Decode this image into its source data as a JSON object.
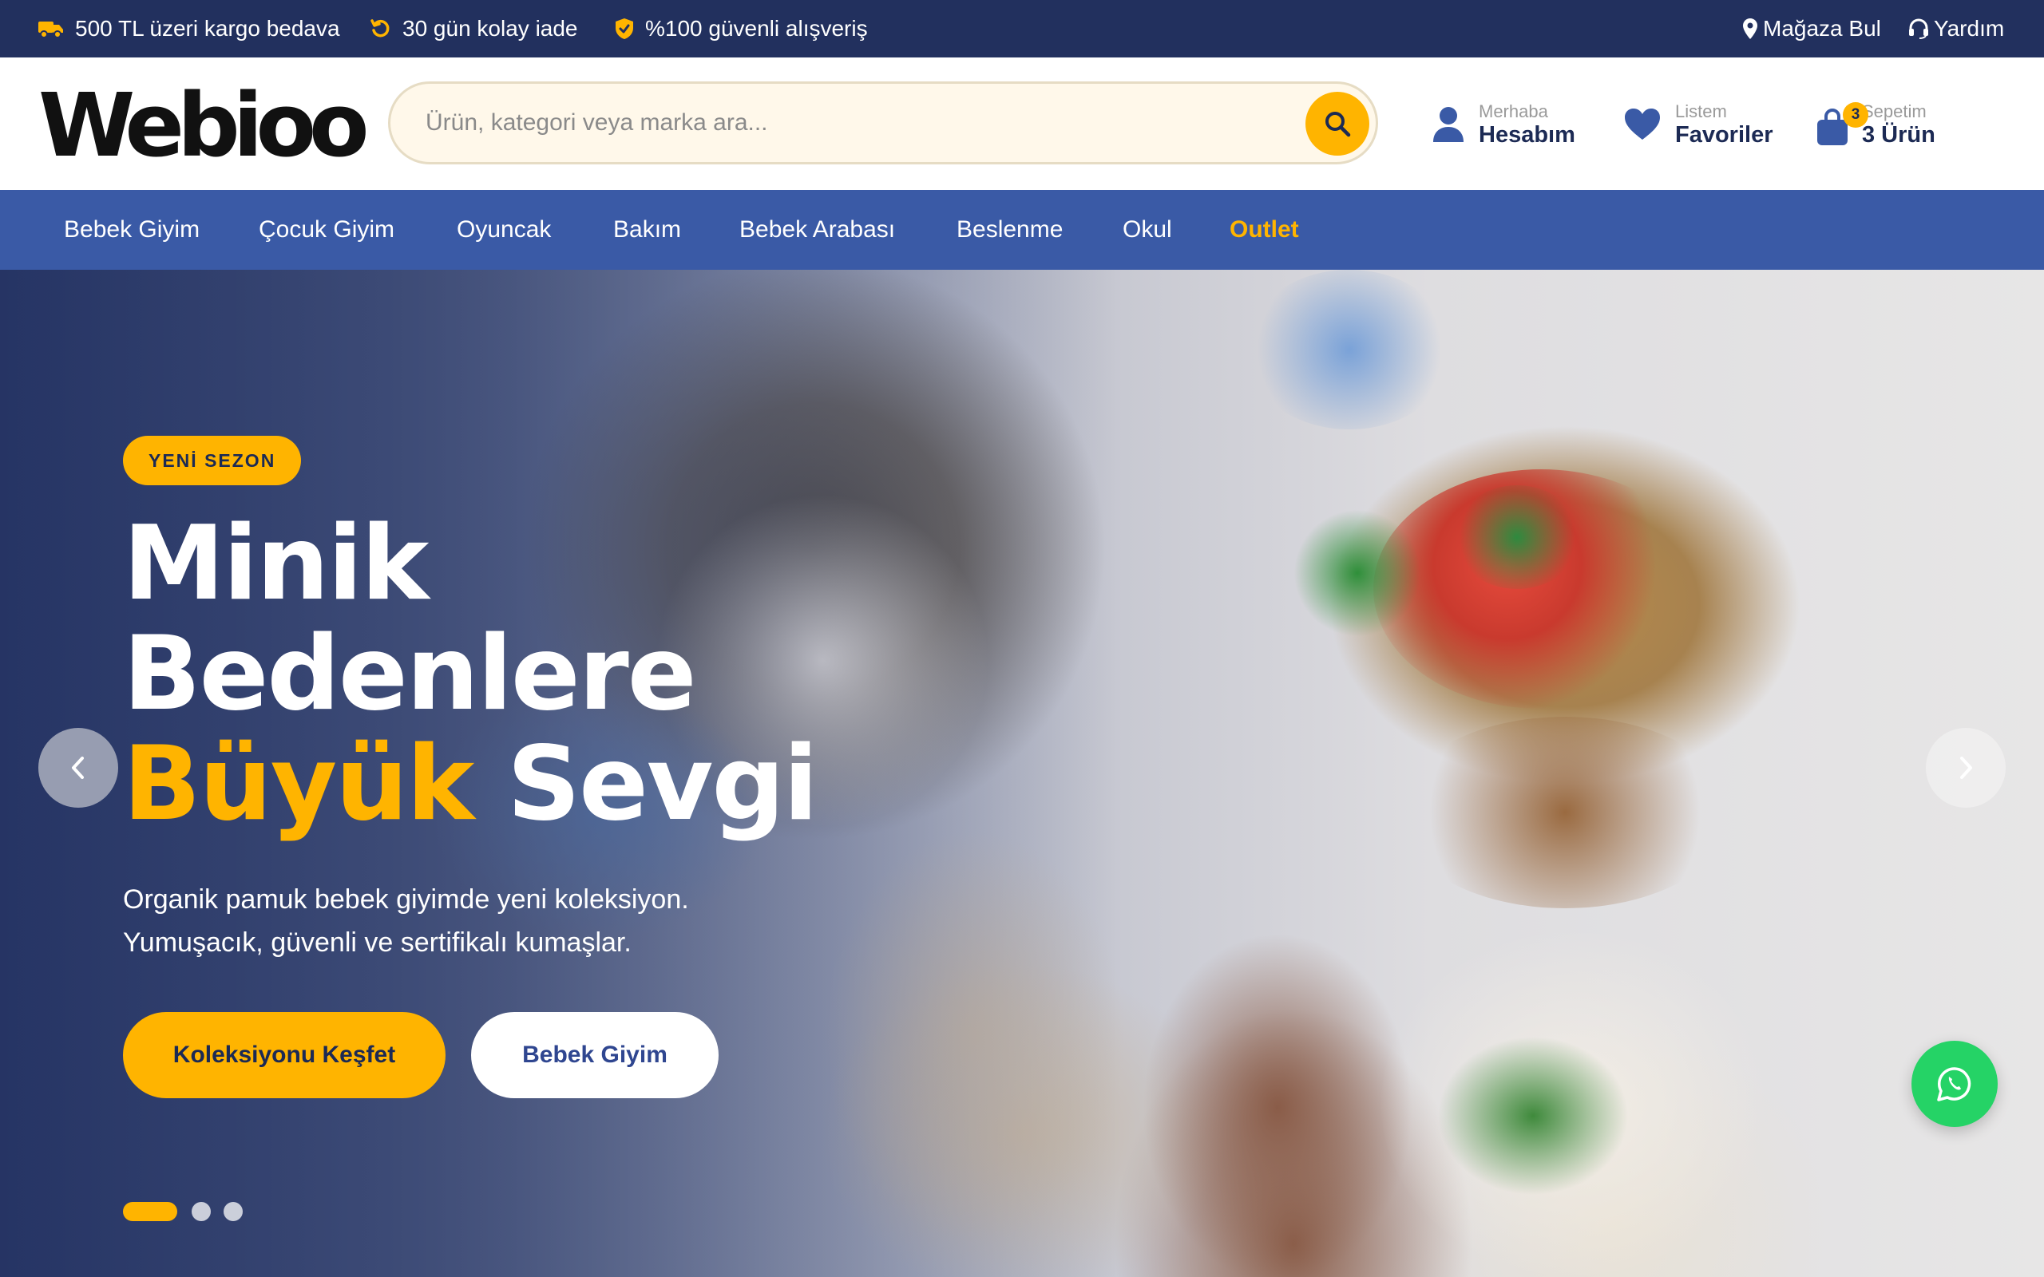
{
  "topbar": {
    "items": [
      {
        "label": "500 TL üzeri kargo bedava",
        "icon": "truck-icon"
      },
      {
        "label": "30 gün kolay iade",
        "icon": "return-icon"
      },
      {
        "label": "%100 güvenli alışveriş",
        "icon": "shield-icon"
      }
    ],
    "store_finder": "Mağaza Bul",
    "help": "Yardım"
  },
  "header": {
    "logo": "Webioo",
    "search_placeholder": "Ürün, kategori veya marka ara...",
    "account": {
      "small": "Merhaba",
      "big": "Hesabım"
    },
    "favorites": {
      "small": "Listem",
      "big": "Favoriler"
    },
    "cart": {
      "small": "Sepetim",
      "big": "3 Ürün",
      "count": "3"
    }
  },
  "nav": {
    "items": [
      "Bebek Giyim",
      "Çocuk Giyim",
      "Oyuncak",
      "Bakım",
      "Bebek Arabası",
      "Beslenme",
      "Okul",
      "Outlet"
    ]
  },
  "hero": {
    "badge": "YENİ SEZON",
    "headline": {
      "line1": "Minik",
      "line2": "Bedenlere",
      "highlight": "Büyük",
      "line3_rest": " Sevgi"
    },
    "subtitle_1": "Organik pamuk bebek giyimde yeni koleksiyon.",
    "subtitle_2": "Yumuşacık, güvenli ve sertifikalı kumaşlar.",
    "primary_button": "Koleksiyonu Keşfet",
    "secondary_button": "Bebek Giyim",
    "slide_count": 3,
    "active_slide": 1
  },
  "colors": {
    "topbar": "#22305e",
    "nav": "#3a5aa6",
    "accent": "#ffb400",
    "primary_text": "#1c2a54",
    "whatsapp": "#25d366"
  }
}
